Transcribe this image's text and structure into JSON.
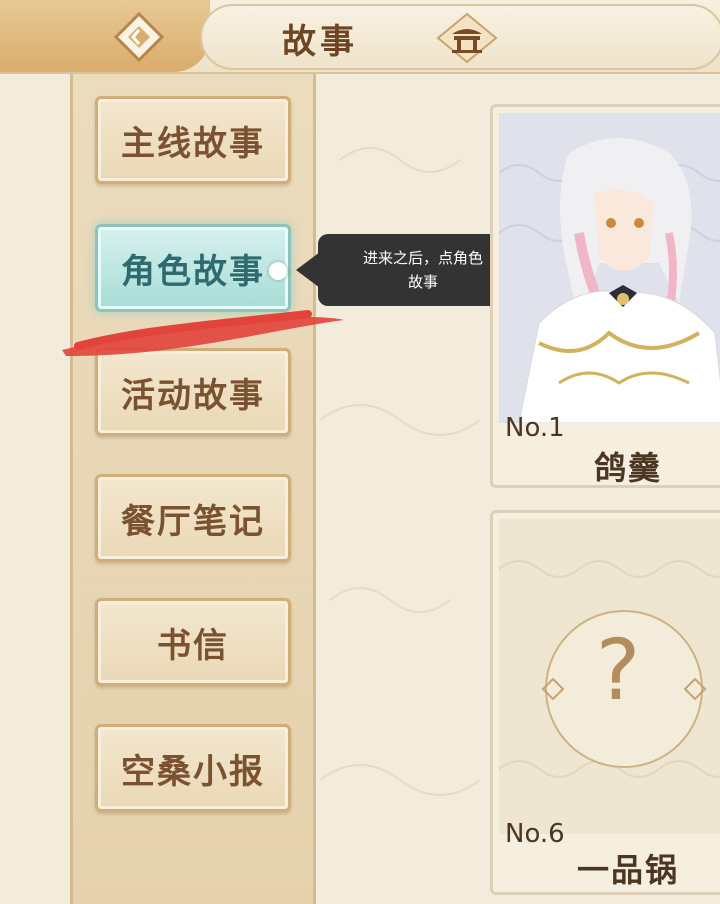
{
  "header": {
    "title": "故事",
    "back_icon": "back-arrow-icon",
    "home_icon": "pavilion-home-icon"
  },
  "sidebar": {
    "items": [
      {
        "label": "主线故事",
        "active": false
      },
      {
        "label": "角色故事",
        "active": true
      },
      {
        "label": "活动故事",
        "active": false
      },
      {
        "label": "餐厅笔记",
        "active": false
      },
      {
        "label": "书信",
        "active": false
      },
      {
        "label": "空桑小报",
        "active": false
      }
    ]
  },
  "tooltip": {
    "text_line1": "进来之后，点角色",
    "text_line2": "故事"
  },
  "cards": [
    {
      "number": "No.1",
      "name": "鸽羹",
      "locked": false
    },
    {
      "number": "No.6",
      "name": "一品锅",
      "locked": true,
      "placeholder": "?"
    }
  ],
  "colors": {
    "accent_gold": "#d9ad6d",
    "active_teal": "#a6dcd6",
    "text_brown": "#7a5232",
    "scribble_red": "#e2433b"
  }
}
